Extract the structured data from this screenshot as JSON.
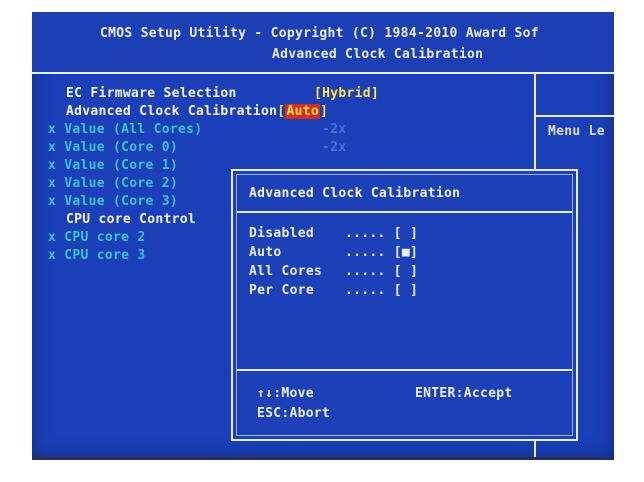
{
  "header": {
    "title_line1": "CMOS Setup Utility - Copyright (C) 1984-2010 Award Sof",
    "title_line2": "Advanced Clock Calibration"
  },
  "help_panel": {
    "label": "Menu Le"
  },
  "settings": [
    {
      "label": "EC Firmware Selection",
      "value": "[Hybrid]",
      "state": "enabled"
    },
    {
      "label": "Advanced Clock Calibration",
      "value_open": "[",
      "value": "Auto",
      "value_close": "]",
      "state": "selected"
    },
    {
      "marker": "x",
      "label": "Value (All Cores)",
      "value": "-2x",
      "state": "disabled"
    },
    {
      "marker": "x",
      "label": "Value (Core 0)",
      "value": "-2x",
      "state": "disabled"
    },
    {
      "marker": "x",
      "label": "Value (Core 1)",
      "state": "disabled"
    },
    {
      "marker": "x",
      "label": "Value (Core 2)",
      "state": "disabled"
    },
    {
      "marker": "x",
      "label": "Value (Core 3)",
      "state": "disabled"
    },
    {
      "label": "CPU core Control",
      "state": "enabled"
    },
    {
      "marker": "x",
      "label": "CPU core 2",
      "state": "disabled"
    },
    {
      "marker": "x",
      "label": "CPU core 3",
      "state": "disabled"
    }
  ],
  "popup": {
    "title": "Advanced Clock Calibration",
    "options": [
      {
        "label": "Disabled",
        "dots": ".....",
        "check": "[ ]",
        "selected": false
      },
      {
        "label": "Auto",
        "dots": ".....",
        "check": "[■]",
        "selected": true
      },
      {
        "label": "All Cores",
        "dots": ".....",
        "check": "[ ]",
        "selected": false
      },
      {
        "label": "Per Core",
        "dots": ".....",
        "check": "[ ]",
        "selected": false
      }
    ],
    "footer": {
      "move": "↑↓:Move",
      "accept": "ENTER:Accept",
      "abort": "ESC:Abort"
    }
  },
  "colors": {
    "background": "#1a3fb8",
    "text_white": "#f2f4fa",
    "value_yellow": "#ffe640",
    "disabled_cyan": "#35c6d0",
    "disabled_value": "#4a6fd8",
    "highlight_red": "#d92b1e"
  }
}
